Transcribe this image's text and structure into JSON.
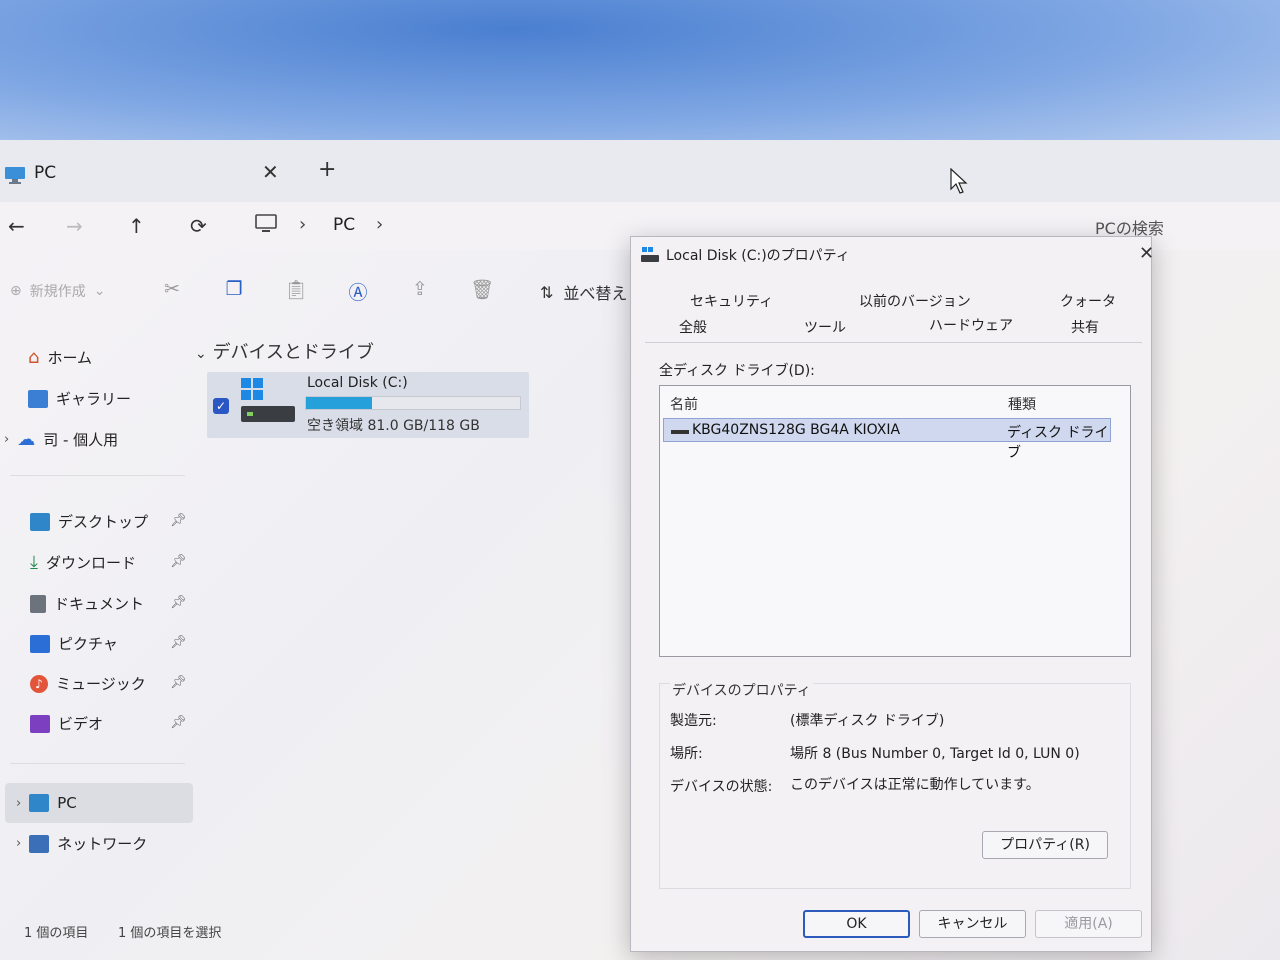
{
  "explorer": {
    "tab_title": "PC",
    "tab_close": "✕",
    "tab_add": "+",
    "breadcrumb_pc": "PC",
    "search_placeholder": "PCの検索",
    "cmd_new": "新規作成",
    "cmd_sort": "並べ替え",
    "section_title": "デバイスとドライブ",
    "drive": {
      "name": "Local Disk (C:)",
      "free_text": "空き領域 81.0 GB/118 GB",
      "used_fraction": 0.31
    },
    "sidebar": {
      "home": "ホーム",
      "gallery": "ギャラリー",
      "onedrive": "司 - 個人用",
      "desktop": "デスクトップ",
      "downloads": "ダウンロード",
      "documents": "ドキュメント",
      "pictures": "ピクチャ",
      "music": "ミュージック",
      "videos": "ビデオ",
      "pc": "PC",
      "network": "ネットワーク"
    },
    "status_items": "1 個の項目",
    "status_selected": "1 個の項目を選択"
  },
  "dialog": {
    "title": "Local Disk (C:)のプロパティ",
    "close": "✕",
    "tabs": {
      "security": "セキュリティ",
      "previous_versions": "以前のバージョン",
      "quota": "クォータ",
      "general": "全般",
      "tools": "ツール",
      "hardware": "ハードウェア",
      "sharing": "共有"
    },
    "all_disks_label": "全ディスク ドライブ(D):",
    "columns": {
      "name": "名前",
      "type": "種類"
    },
    "disk_row": {
      "name": "KBG40ZNS128G BG4A KIOXIA",
      "type": "ディスク ドライブ"
    },
    "device_props": {
      "legend": "デバイスのプロパティ",
      "manufacturer_label": "製造元:",
      "manufacturer_value": "(標準ディスク ドライブ)",
      "location_label": "場所:",
      "location_value": "場所 8 (Bus Number 0, Target Id 0, LUN 0)",
      "status_label": "デバイスの状態:",
      "status_value": "このデバイスは正常に動作しています。"
    },
    "properties_button": "プロパティ(R)",
    "ok": "OK",
    "cancel": "キャンセル",
    "apply": "適用(A)"
  }
}
